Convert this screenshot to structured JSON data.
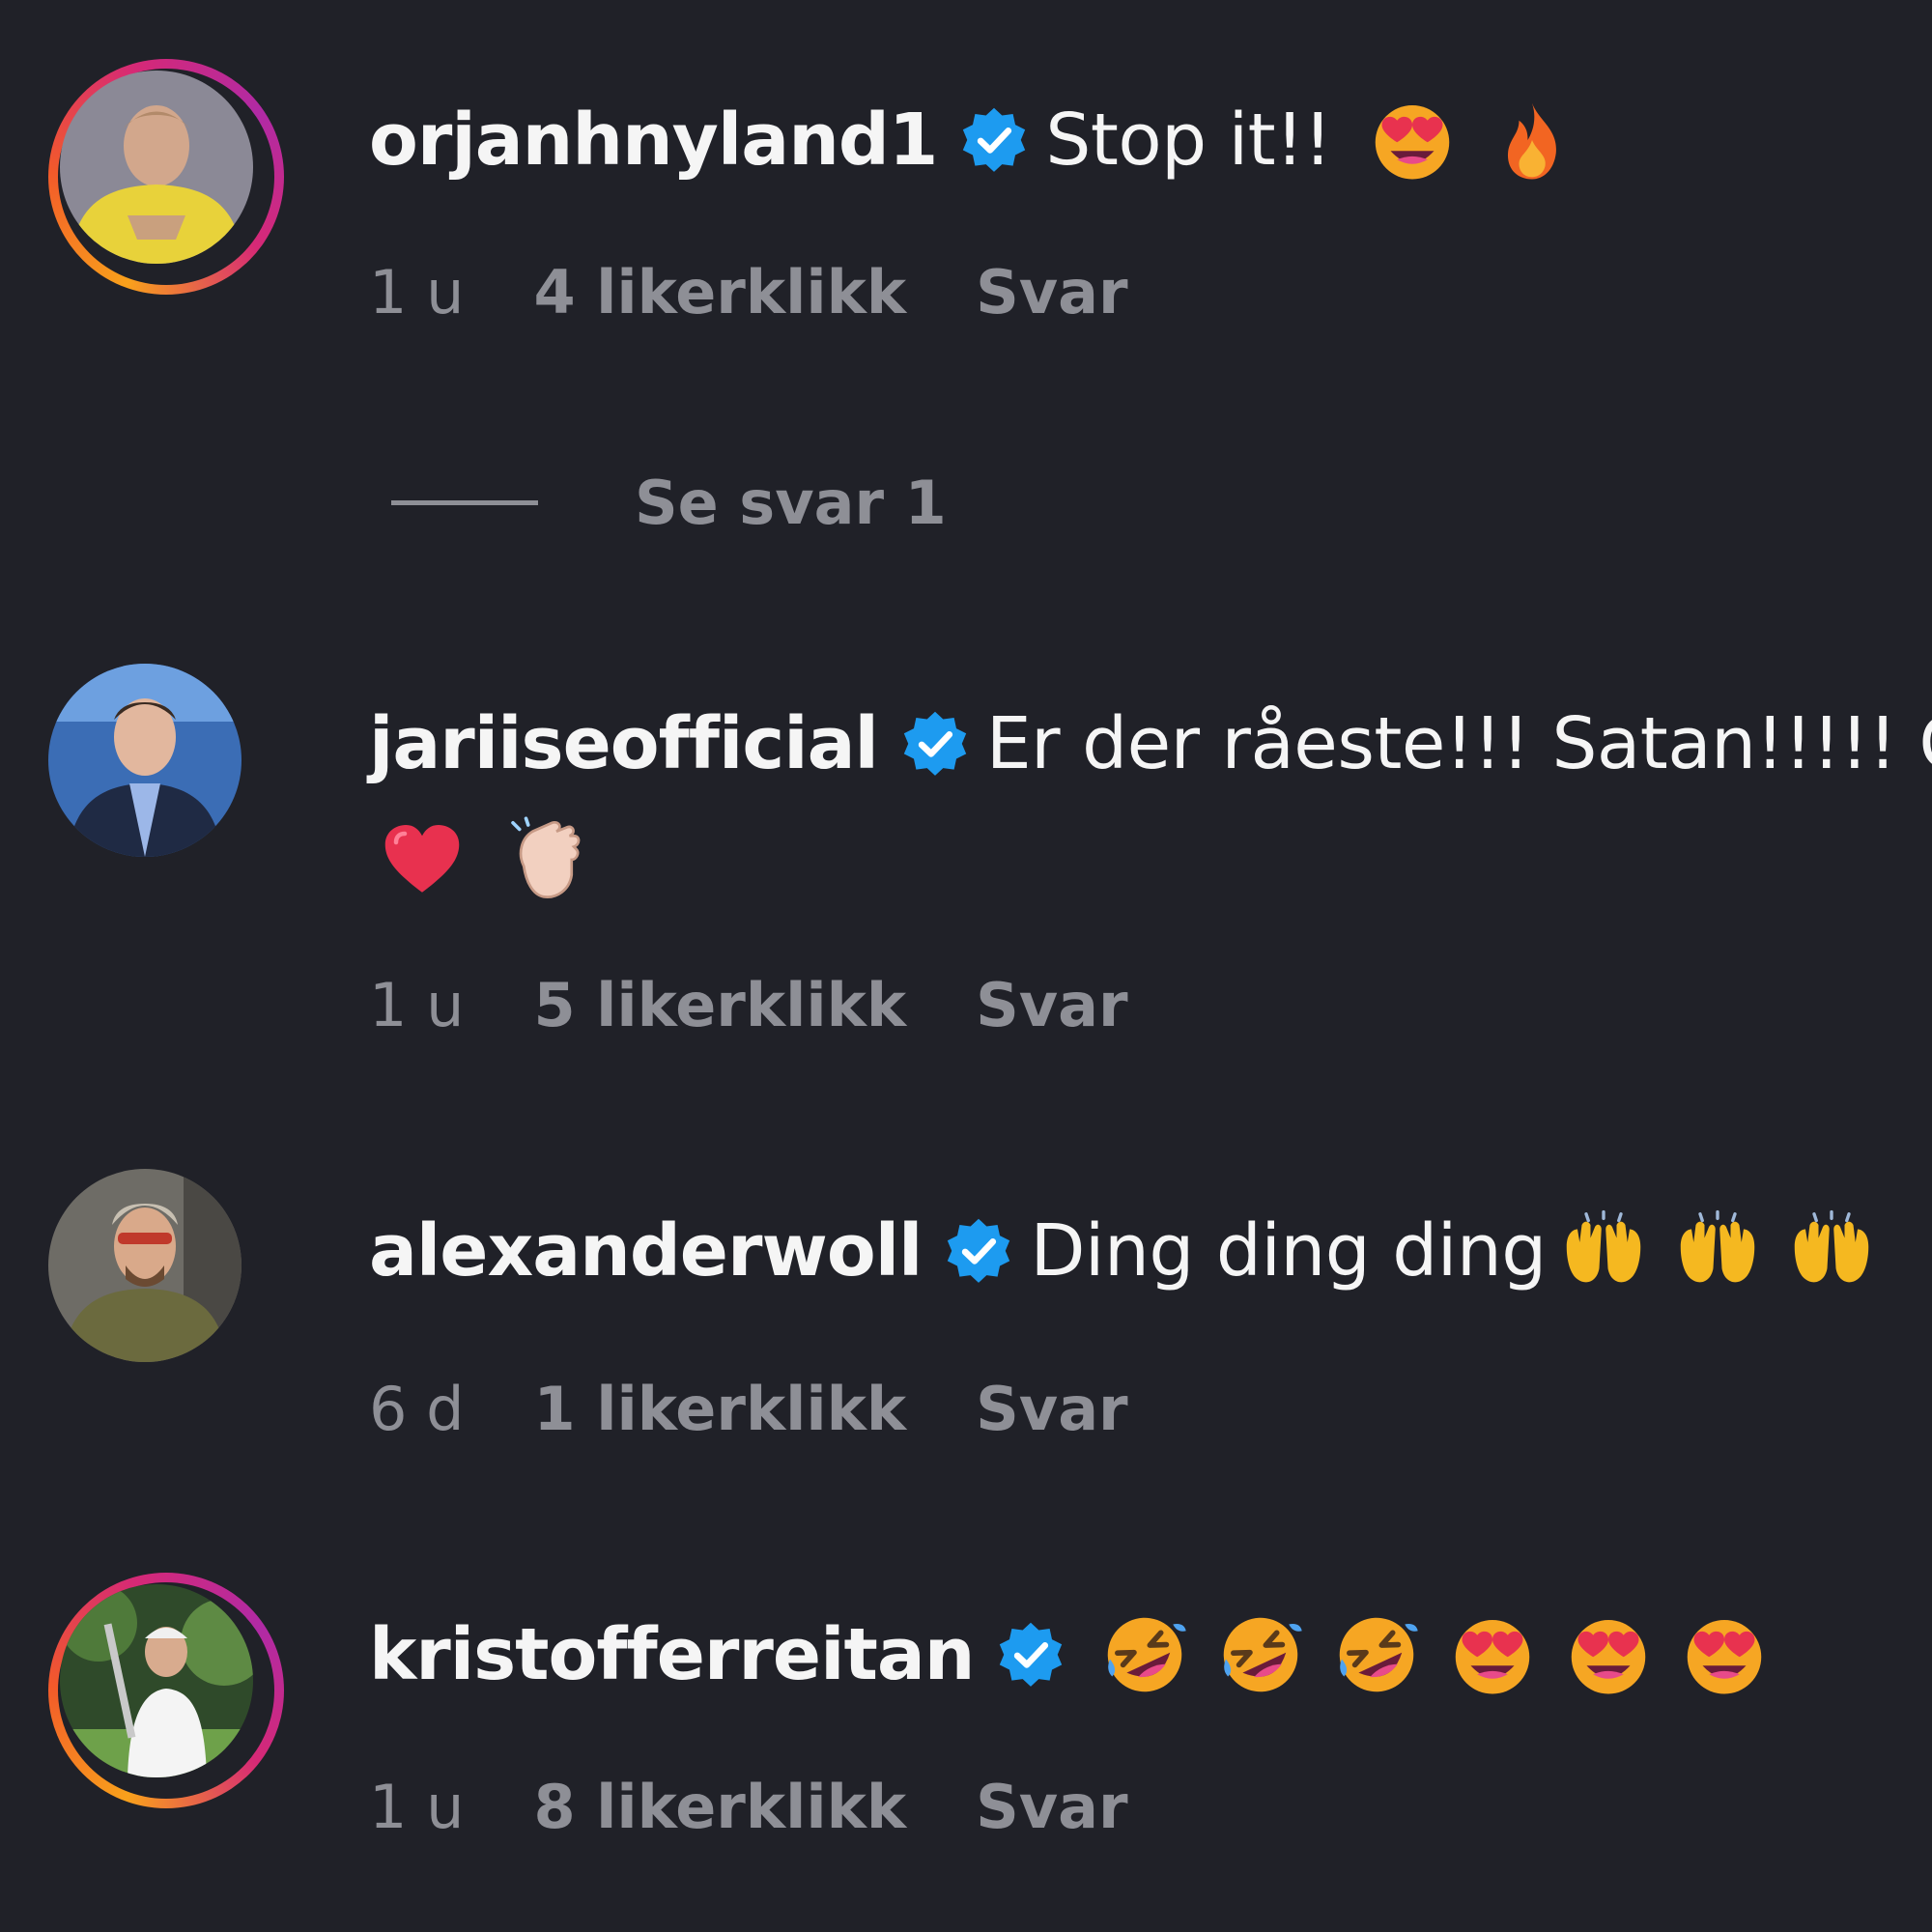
{
  "comments": [
    {
      "username": "orjanhnyland1",
      "text": "Stop it!!",
      "emojis": [
        "heart-eyes-emoji",
        "fire-emoji"
      ],
      "time": "1 u",
      "likes": "4 likerklikk",
      "reply": "Svar",
      "story_ring": true
    },
    {
      "username": "jariiseofficial",
      "text": "Er der råeste!!! Satan!!!!! G",
      "emojis_line2": [
        "red-heart-emoji",
        "clapping-hands-emoji"
      ],
      "time": "1 u",
      "likes": "5 likerklikk",
      "reply": "Svar",
      "story_ring": false
    },
    {
      "username": "alexanderwoll",
      "text": "Ding ding ding",
      "emojis": [
        "raising-hands-emoji",
        "raising-hands-emoji",
        "raising-hands-emoji"
      ],
      "time": "6 d",
      "likes": "1 likerklikk",
      "reply": "Svar",
      "story_ring": false
    },
    {
      "username": "kristofferreitan",
      "text": "",
      "emojis": [
        "rofl-emoji",
        "rofl-emoji",
        "rofl-emoji",
        "heart-eyes-emoji",
        "heart-eyes-emoji",
        "heart-eyes-emoji"
      ],
      "time": "1 u",
      "likes": "8 likerklikk",
      "reply": "Svar",
      "story_ring": true
    }
  ],
  "see_replies": "Se svar 1",
  "colors": {
    "background": "#202128",
    "text": "#f5f5f5",
    "secondary": "#8e8f96",
    "verified": "#1d9bf0"
  }
}
